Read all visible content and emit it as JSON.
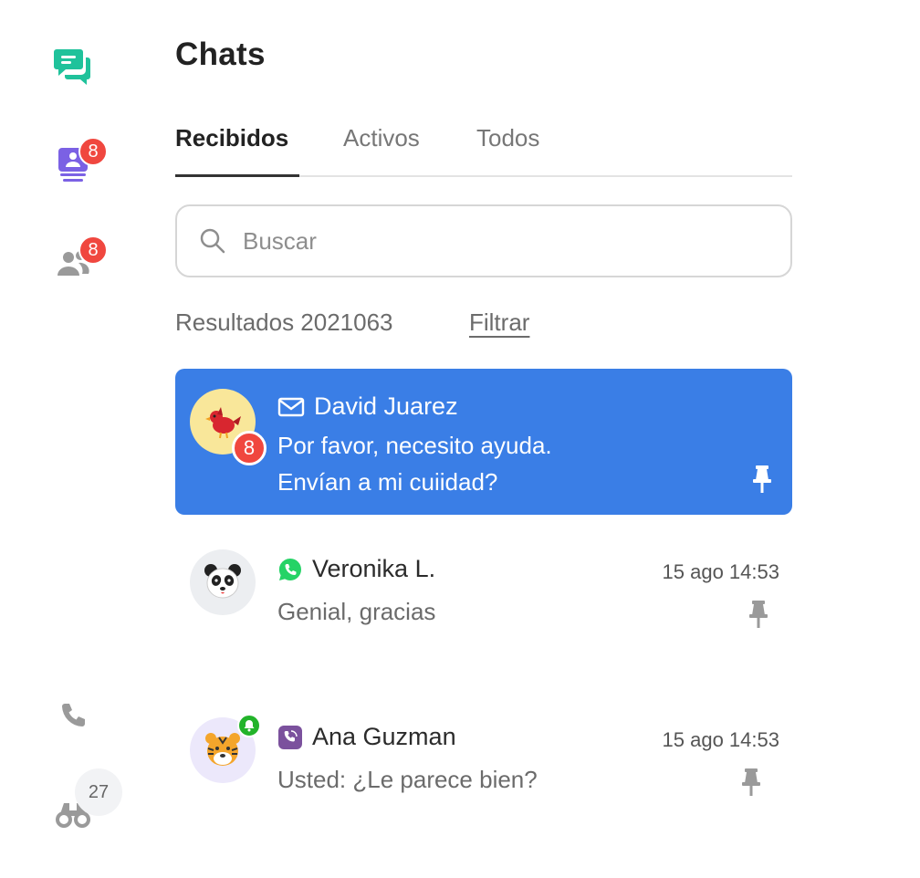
{
  "sidebar": {
    "items": [
      {
        "name": "chats",
        "icon": "chat-bubbles-icon",
        "color": "#1fc29b",
        "badge": ""
      },
      {
        "name": "inbox",
        "icon": "inbox-user-icon",
        "color": "#7b61e4",
        "badge": "8"
      },
      {
        "name": "contacts",
        "icon": "users-icon",
        "color": "#9a9a9a",
        "badge": "8"
      },
      {
        "name": "calls",
        "icon": "phone-icon",
        "color": "#9a9a9a",
        "badge": ""
      },
      {
        "name": "visitors",
        "icon": "binoculars-icon",
        "color": "#9a9a9a",
        "badge": "27"
      }
    ]
  },
  "header": {
    "title": "Chats"
  },
  "tabs": [
    {
      "label": "Recibidos",
      "active": true
    },
    {
      "label": "Activos",
      "active": false
    },
    {
      "label": "Todos",
      "active": false
    }
  ],
  "search": {
    "placeholder": "Buscar",
    "value": ""
  },
  "results": {
    "label": "Resultados 2021063",
    "filter_label": "Filtrar"
  },
  "chats": [
    {
      "name": "David Juarez",
      "channel_icon": "mail-icon",
      "avatar_icon": "bird-icon",
      "avatar_bg": "#f9e79a",
      "unread": "8",
      "preview_lines": [
        "Por favor, necesito ayuda.",
        "Envían a mi cuiidad?"
      ],
      "time": "",
      "pinned": true,
      "selected": true
    },
    {
      "name": "Veronika L.",
      "channel_icon": "whatsapp-icon",
      "avatar_icon": "panda-icon",
      "avatar_bg": "#eceef1",
      "unread": "",
      "preview_lines": [
        "Genial, gracias"
      ],
      "time": "15 ago 14:53",
      "pinned": true,
      "selected": false
    },
    {
      "name": "Ana Guzman",
      "channel_icon": "viber-icon",
      "avatar_icon": "tiger-icon",
      "avatar_bg": "#ece8fb",
      "unread": "",
      "notification": "bell-icon",
      "preview_lines": [
        "Usted: ¿Le parece bien?"
      ],
      "time": "15 ago 14:53",
      "pinned": true,
      "selected": false
    }
  ],
  "colors": {
    "accent": "#3a7ee6",
    "badge": "#f0473f",
    "whatsapp": "#25d366",
    "viber": "#7b519d"
  }
}
